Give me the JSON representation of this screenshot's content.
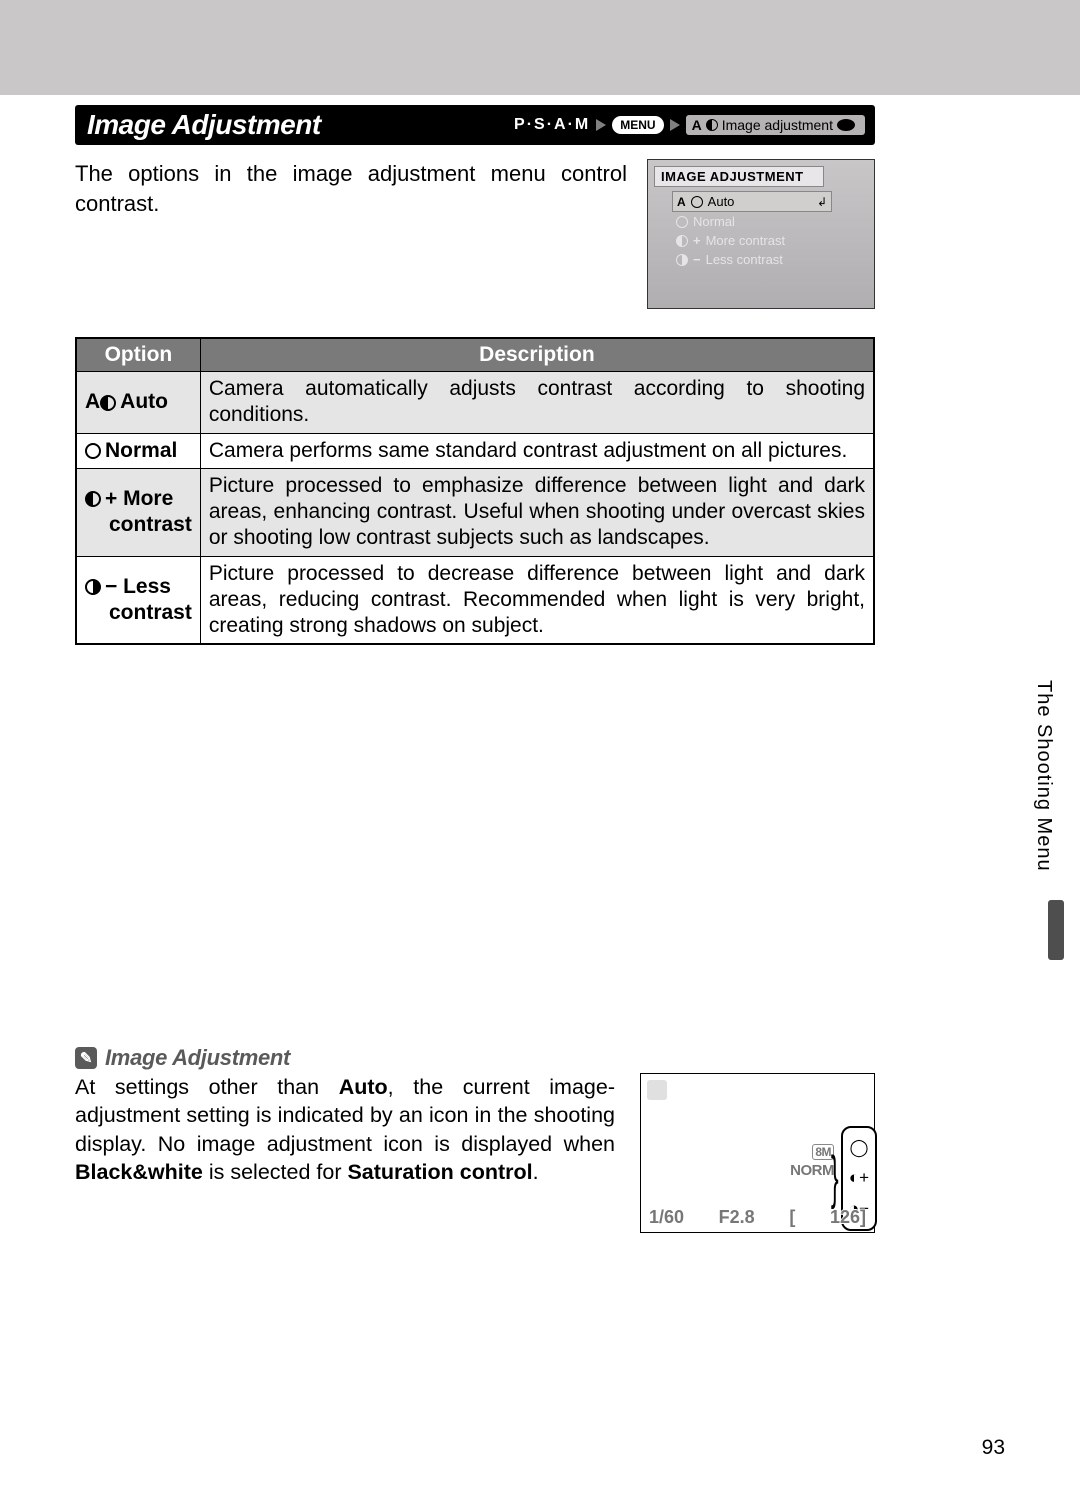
{
  "top": {
    "title": "Image Adjustment",
    "breadcrumb_psam": "P·S·A·M",
    "breadcrumb_menu": "MENU",
    "breadcrumb_icon_label": "A",
    "breadcrumb_last": "Image adjustment"
  },
  "intro": "The options in the image adjustment menu control contrast.",
  "camera_screen": {
    "title": "IMAGE ADJUSTMENT",
    "items": [
      {
        "label": "Auto",
        "prefix": "A",
        "selected": true
      },
      {
        "label": "Normal",
        "prefix": "",
        "selected": false
      },
      {
        "label": "More contrast",
        "prefix": "+",
        "selected": false
      },
      {
        "label": "Less contrast",
        "prefix": "−",
        "selected": false
      }
    ]
  },
  "table": {
    "head_option": "Option",
    "head_desc": "Description",
    "rows": [
      {
        "icon": "A◐",
        "name": "Auto",
        "name_line2": "",
        "desc": "Camera automatically adjusts contrast according to shooting conditions.",
        "shade": true
      },
      {
        "icon": "◯",
        "name": "Normal",
        "name_line2": "",
        "desc": "Camera performs same standard contrast adjustment on all pictures.",
        "shade": false
      },
      {
        "icon": "◐+",
        "name": "More",
        "name_line2": "contrast",
        "desc": "Picture processed to emphasize difference between light and dark areas, enhancing contrast.  Useful when shooting under overcast skies or shooting low contrast subjects such as landscapes.",
        "shade": true
      },
      {
        "icon": "◑−",
        "name": "Less",
        "name_line2": "contrast",
        "desc": "Picture processed to decrease difference between light and dark areas, reducing contrast.  Recommended when light is very bright, creating strong shadows on subject.",
        "shade": false
      }
    ]
  },
  "side_tab": "The Shooting Menu",
  "note": {
    "heading": "Image Adjustment",
    "body_parts": {
      "p1": "At settings other than ",
      "b1": "Auto",
      "p2": ", the current image-adjustment setting is indicated by an icon in the shooting display.  No image adjustment icon is displayed when ",
      "b2": "Black&white",
      "p3": " is selected for ",
      "b3": "Saturation control",
      "p4": "."
    }
  },
  "lcd": {
    "stack": {
      "size": "8M",
      "qual": "NORM"
    },
    "bottom": {
      "shutter": "1/60",
      "aperture": "F2.8",
      "bracket": "[",
      "count": "126]"
    },
    "callout_icons": [
      "◯",
      "◐+",
      "◑−"
    ]
  },
  "page_number": "93"
}
